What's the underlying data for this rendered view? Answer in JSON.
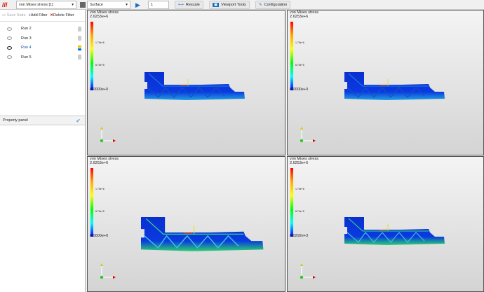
{
  "toolbar": {
    "field": "von Mises stress [1]",
    "representation": "Surface",
    "frame": "1",
    "rescale": "Rescale",
    "viewport_tools": "Viewport Tools",
    "configuration": "Configuration"
  },
  "left_panel": {
    "save_state": "Save State",
    "add_filter": "Add Filter",
    "delete_filter": "Delete Filter",
    "runs": [
      {
        "label": "Run 2",
        "active": false
      },
      {
        "label": "Run 3",
        "active": false
      },
      {
        "label": "Run 4",
        "active": true
      },
      {
        "label": "Run 5",
        "active": false
      }
    ],
    "property_panel": "Property panel"
  },
  "viewports": [
    {
      "title": "von Mises stress",
      "max": "2.6253e+6",
      "mid1": "1.75e+6",
      "mid2": "8.75e+5",
      "min": "0.0000e+0"
    },
    {
      "title": "von Mises stress",
      "max": "2.6253e+6",
      "mid1": "1.75e+6",
      "mid2": "8.75e+5",
      "min": "0.0000e+0"
    },
    {
      "title": "von Mises stress",
      "max": "2.6253e+6",
      "mid1": "1.75e+6",
      "mid2": "8.75e+5",
      "min": "0.0000e+0"
    },
    {
      "title": "von Mises stress",
      "max": "2.6253e+6",
      "mid1": "1.75e+6",
      "mid2": "8.79e+5",
      "min": "6.0292e+3"
    }
  ],
  "colors": {
    "accent": "#1a5fa8",
    "active_run": "#1a4f9c"
  }
}
